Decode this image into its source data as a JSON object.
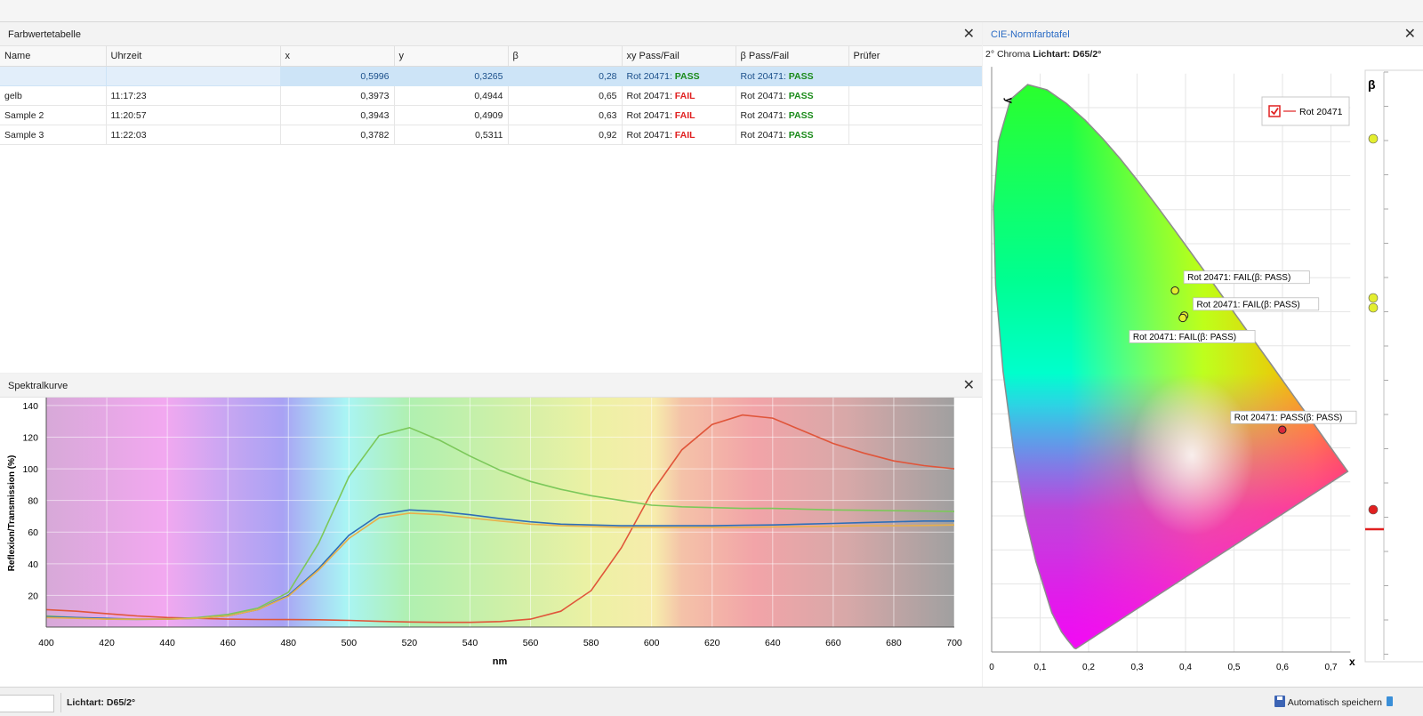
{
  "color_table": {
    "title": "Farbwertetabelle",
    "columns": [
      "Name",
      "Uhrzeit",
      "x",
      "y",
      "β",
      "xy Pass/Fail",
      "β Pass/Fail",
      "Prüfer"
    ],
    "rows": [
      {
        "name": "",
        "time": "",
        "x": "0,5996",
        "y": "0,3265",
        "beta": "0,28",
        "xy_ref": "Rot 20471: ",
        "xy_status": "PASS",
        "beta_ref": "Rot 20471: ",
        "beta_status": "PASS",
        "checker": ""
      },
      {
        "name": "gelb",
        "time": "11:17:23",
        "x": "0,3973",
        "y": "0,4944",
        "beta": "0,65",
        "xy_ref": "Rot 20471: ",
        "xy_status": "FAIL",
        "beta_ref": "Rot 20471: ",
        "beta_status": "PASS",
        "checker": ""
      },
      {
        "name": "Sample 2",
        "time": "11:20:57",
        "x": "0,3943",
        "y": "0,4909",
        "beta": "0,63",
        "xy_ref": "Rot 20471: ",
        "xy_status": "FAIL",
        "beta_ref": "Rot 20471: ",
        "beta_status": "PASS",
        "checker": ""
      },
      {
        "name": "Sample 3",
        "time": "11:22:03",
        "x": "0,3782",
        "y": "0,5311",
        "beta": "0,92",
        "xy_ref": "Rot 20471: ",
        "xy_status": "FAIL",
        "beta_ref": "Rot 20471: ",
        "beta_status": "PASS",
        "checker": ""
      }
    ],
    "close_glyph": "✕"
  },
  "spectral": {
    "title": "Spektralkurve",
    "close_glyph": "✕"
  },
  "cie": {
    "title": "CIE-Normfarbtafel",
    "subtitle_prefix": "2° Chroma ",
    "subtitle_bold": "Lichtart: D65/2°",
    "legend_label": "Rot 20471",
    "beta_label": "β",
    "close_glyph": "✕"
  },
  "statusbar": {
    "illuminant": "Lichtart: D65/2°",
    "autosave": "Automatisch speichern"
  },
  "colors": {
    "pass": "#1a8a1a",
    "fail": "#e02020",
    "accent": "#2a6bc4",
    "selection": "#cde4f7"
  },
  "chart_data": [
    {
      "type": "line",
      "title": "",
      "xlabel": "nm",
      "ylabel": "Reflexion/Transmission (%)",
      "xlim": [
        400,
        700
      ],
      "ylim": [
        0,
        145
      ],
      "xticks": [
        400,
        420,
        440,
        460,
        480,
        500,
        520,
        540,
        560,
        580,
        600,
        620,
        640,
        660,
        680,
        700
      ],
      "yticks": [
        20,
        40,
        60,
        80,
        100,
        120,
        140
      ],
      "grid": true,
      "series": [
        {
          "color": "#e0553a",
          "x": [
            400,
            410,
            420,
            430,
            440,
            450,
            460,
            470,
            480,
            490,
            500,
            510,
            520,
            530,
            540,
            550,
            560,
            570,
            580,
            590,
            600,
            610,
            620,
            630,
            640,
            650,
            660,
            670,
            680,
            690,
            700
          ],
          "y": [
            11,
            10,
            8.5,
            7,
            6,
            5.5,
            5,
            4.8,
            4.7,
            4.6,
            4.2,
            3.6,
            3.2,
            3,
            3,
            3.5,
            5,
            10,
            23,
            50,
            85,
            112,
            128,
            134,
            132,
            124,
            116,
            110,
            105,
            102,
            100
          ]
        },
        {
          "color": "#7cc85a",
          "x": [
            400,
            410,
            420,
            430,
            440,
            450,
            460,
            470,
            480,
            490,
            500,
            510,
            520,
            530,
            540,
            550,
            560,
            570,
            580,
            590,
            600,
            610,
            620,
            630,
            640,
            650,
            660,
            670,
            680,
            690,
            700
          ],
          "y": [
            7,
            6,
            5,
            4.8,
            5,
            6,
            8,
            12,
            22,
            53,
            95,
            121,
            126,
            118,
            108,
            99,
            92,
            87,
            83,
            80,
            77,
            76,
            75.5,
            75,
            75,
            74.5,
            74,
            73.8,
            73.5,
            73.3,
            73
          ]
        },
        {
          "color": "#2d6eb8",
          "x": [
            400,
            410,
            420,
            430,
            440,
            450,
            460,
            470,
            480,
            490,
            500,
            510,
            520,
            530,
            540,
            550,
            560,
            570,
            580,
            590,
            600,
            610,
            620,
            630,
            640,
            650,
            660,
            670,
            680,
            690,
            700
          ],
          "y": [
            6.5,
            6,
            5.5,
            5,
            5,
            5.5,
            7,
            11,
            20,
            37,
            58,
            71,
            74,
            73,
            71,
            68.5,
            66.5,
            65,
            64.5,
            64,
            64,
            64,
            64,
            64.3,
            64.5,
            65,
            65.5,
            66,
            66.5,
            67,
            67
          ]
        },
        {
          "color": "#e8b04a",
          "x": [
            400,
            410,
            420,
            430,
            440,
            450,
            460,
            470,
            480,
            490,
            500,
            510,
            520,
            530,
            540,
            550,
            560,
            570,
            580,
            590,
            600,
            610,
            620,
            630,
            640,
            650,
            660,
            670,
            680,
            690,
            700
          ],
          "y": [
            6,
            5.5,
            5,
            5,
            5,
            5.5,
            7,
            11,
            19.5,
            36,
            56,
            69,
            72,
            71,
            69,
            67,
            65,
            64,
            63.5,
            63,
            63,
            63,
            63,
            63,
            63.3,
            63.5,
            63.7,
            64,
            64,
            64.2,
            64.5
          ]
        }
      ]
    },
    {
      "type": "scatter",
      "title": "",
      "xlabel": "x",
      "ylabel": "y",
      "xlim": [
        0,
        0.75
      ],
      "ylim": [
        0,
        0.85
      ],
      "xticks": [
        "0",
        "0,1",
        "0,2",
        "0,3",
        "0,4",
        "0,5",
        "0,6",
        "0,7"
      ],
      "yticks": [
        "0",
        "0,05",
        "0,1",
        "0,15",
        "0,2",
        "0,25",
        "0,3",
        "0,35",
        "0,4",
        "0,45",
        "0,5",
        "0,55",
        "0,6",
        "0,65",
        "0,7",
        "0,75",
        "0,8"
      ],
      "points": [
        {
          "x": 0.5996,
          "y": 0.3265,
          "label": "Rot 20471: PASS(β: PASS)",
          "fill": "#d8283a"
        },
        {
          "x": 0.3973,
          "y": 0.4944,
          "label": "Rot 20471: FAIL(β: PASS)",
          "fill": "#e3ee30"
        },
        {
          "x": 0.3943,
          "y": 0.4909,
          "label": "Rot 20471: FAIL(β: PASS)",
          "fill": "#e3ee30"
        },
        {
          "x": 0.3782,
          "y": 0.5311,
          "label": "Rot 20471: FAIL(β: PASS)",
          "fill": "#e3ee30"
        }
      ]
    }
  ]
}
